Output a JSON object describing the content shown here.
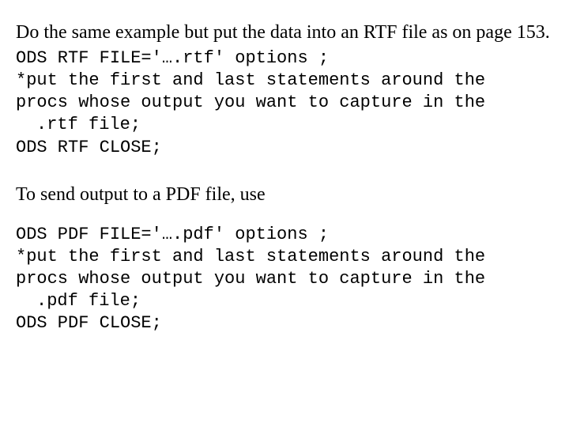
{
  "para1_text": "Do the same example but put the data into an RTF file as on page 153.",
  "code_rtf": {
    "l1": "ODS RTF FILE='….rtf' options ;",
    "l2": "*put the first and last statements around the",
    "l3": "procs whose output you want to capture in the",
    "l4": ".rtf file;",
    "l5": "ODS RTF CLOSE;"
  },
  "para2_text": "To send output to a PDF file, use",
  "code_pdf": {
    "l1": "ODS PDF FILE='….pdf' options ;",
    "l2": "*put the first and last statements around the",
    "l3": "procs whose output you want to capture in the",
    "l4": ".pdf file;",
    "l5": "ODS PDF CLOSE;"
  }
}
